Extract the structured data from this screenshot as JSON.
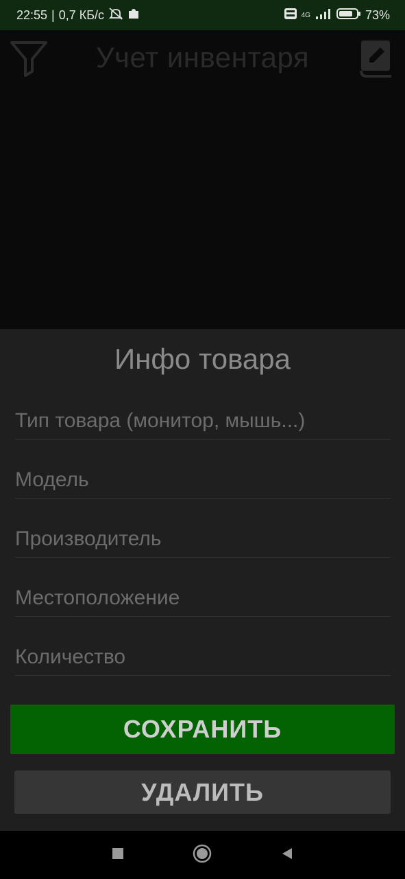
{
  "status": {
    "time": "22:55",
    "speed": "0,7 КБ/с",
    "network": "4G",
    "battery": "73%"
  },
  "app": {
    "title": "Учет инвентаря"
  },
  "sheet": {
    "title": "Инфо товара",
    "fields": {
      "type": {
        "placeholder": "Тип товара (монитор, мышь...)"
      },
      "model": {
        "placeholder": "Модель"
      },
      "manufacturer": {
        "placeholder": "Производитель"
      },
      "location": {
        "placeholder": "Местоположение"
      },
      "quantity": {
        "placeholder": "Количество"
      }
    },
    "save_label": "СОХРАНИТЬ",
    "delete_label": "УДАЛИТЬ"
  },
  "icons": {
    "filter": "filter-icon",
    "edit": "edit-book-icon",
    "recent": "square-icon",
    "home": "circle-icon",
    "back": "triangle-back-icon"
  },
  "colors": {
    "status_bar": "#0f2a10",
    "save": "#036303",
    "delete": "#363636",
    "sheet": "#1f1f1f"
  }
}
